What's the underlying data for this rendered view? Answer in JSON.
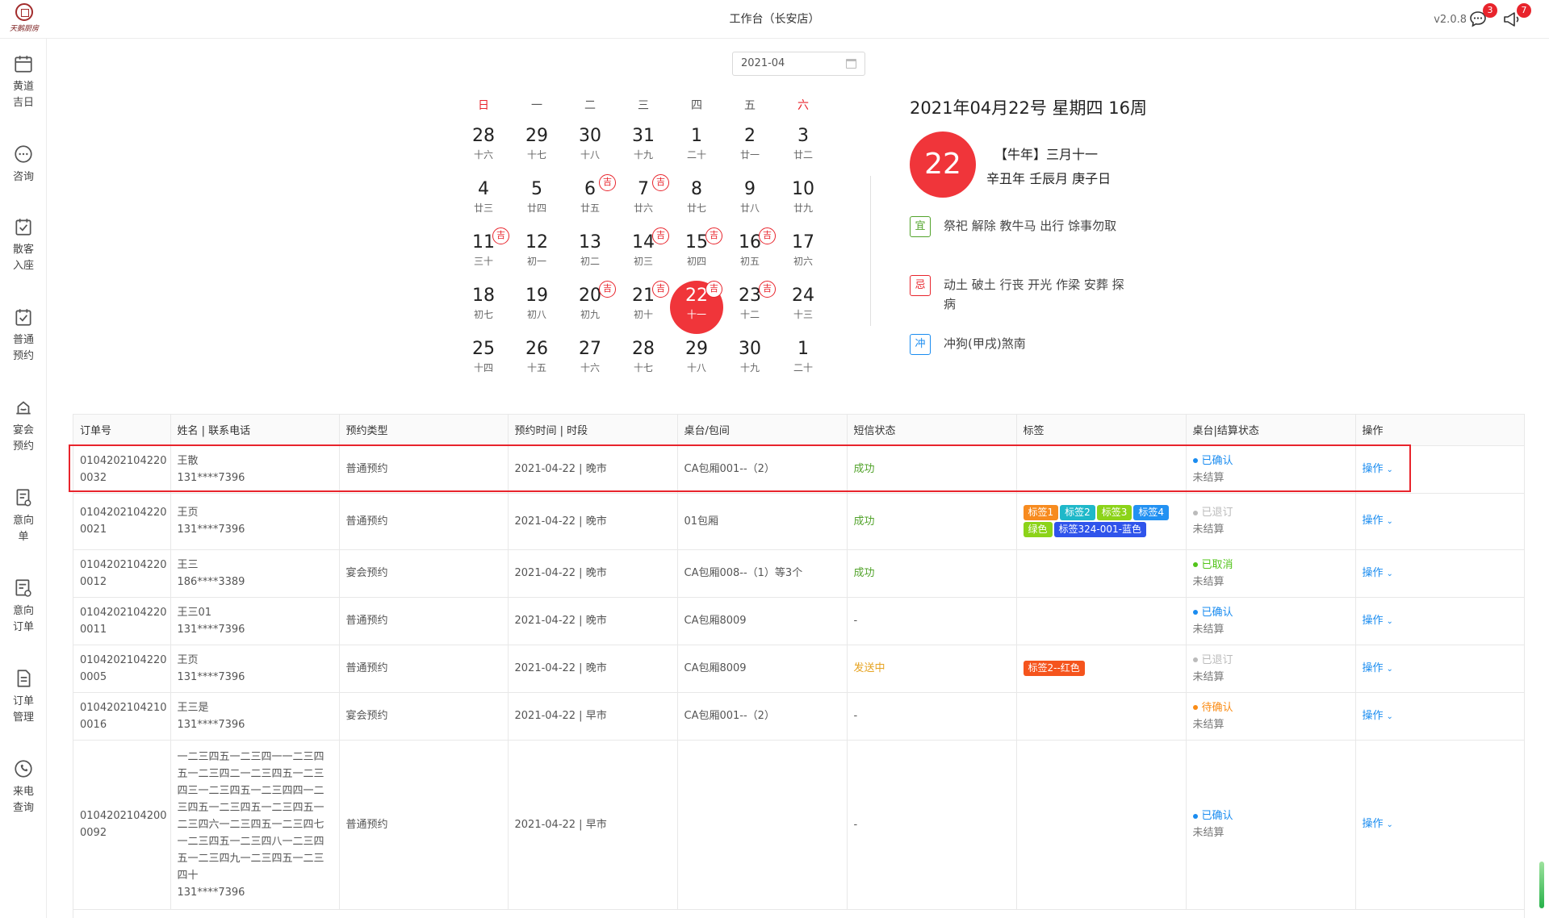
{
  "header": {
    "logo_text": "天鹅厨房",
    "title": "工作台（长安店）",
    "version": "v2.0.8",
    "message_badge": "3",
    "notice_badge": "7"
  },
  "sidebar": {
    "items": [
      {
        "icon": "calendar-icon",
        "label": "黄道\n吉日"
      },
      {
        "icon": "chat-icon",
        "label": "咨询"
      },
      {
        "icon": "checkin-icon",
        "label": "散客\n入座"
      },
      {
        "icon": "booking-icon",
        "label": "普通\n预约"
      },
      {
        "icon": "banquet-icon",
        "label": "宴会\n预约"
      },
      {
        "icon": "intent-icon",
        "label": "意向\n单"
      },
      {
        "icon": "intent-order-icon",
        "label": "意向\n订单"
      },
      {
        "icon": "order-icon",
        "label": "订单\n管理"
      },
      {
        "icon": "phone-icon",
        "label": "来电\n查询"
      }
    ]
  },
  "calendar": {
    "month": "2021-04",
    "weekdays": [
      "日",
      "一",
      "二",
      "三",
      "四",
      "五",
      "六"
    ],
    "ji_label": "吉",
    "weeks": [
      [
        {
          "d": "28",
          "l": "十六"
        },
        {
          "d": "29",
          "l": "十七"
        },
        {
          "d": "30",
          "l": "十八"
        },
        {
          "d": "31",
          "l": "十九"
        },
        {
          "d": "1",
          "l": "二十"
        },
        {
          "d": "2",
          "l": "廿一"
        },
        {
          "d": "3",
          "l": "廿二"
        }
      ],
      [
        {
          "d": "4",
          "l": "廿三"
        },
        {
          "d": "5",
          "l": "廿四"
        },
        {
          "d": "6",
          "l": "廿五",
          "ji": true
        },
        {
          "d": "7",
          "l": "廿六",
          "ji": true
        },
        {
          "d": "8",
          "l": "廿七"
        },
        {
          "d": "9",
          "l": "廿八"
        },
        {
          "d": "10",
          "l": "廿九"
        }
      ],
      [
        {
          "d": "11",
          "l": "三十",
          "ji": true
        },
        {
          "d": "12",
          "l": "初一"
        },
        {
          "d": "13",
          "l": "初二"
        },
        {
          "d": "14",
          "l": "初三",
          "ji": true
        },
        {
          "d": "15",
          "l": "初四",
          "ji": true
        },
        {
          "d": "16",
          "l": "初五",
          "ji": true
        },
        {
          "d": "17",
          "l": "初六"
        }
      ],
      [
        {
          "d": "18",
          "l": "初七"
        },
        {
          "d": "19",
          "l": "初八"
        },
        {
          "d": "20",
          "l": "初九",
          "ji": true
        },
        {
          "d": "21",
          "l": "初十",
          "ji": true
        },
        {
          "d": "22",
          "l": "十一",
          "ji": true,
          "selected": true
        },
        {
          "d": "23",
          "l": "十二",
          "ji": true
        },
        {
          "d": "24",
          "l": "十三"
        }
      ],
      [
        {
          "d": "25",
          "l": "十四"
        },
        {
          "d": "26",
          "l": "十五"
        },
        {
          "d": "27",
          "l": "十六"
        },
        {
          "d": "28",
          "l": "十七"
        },
        {
          "d": "29",
          "l": "十八"
        },
        {
          "d": "30",
          "l": "十九"
        },
        {
          "d": "1",
          "l": "二十"
        }
      ]
    ]
  },
  "day_detail": {
    "heading": "2021年04月22号 星期四 16周",
    "big_day": "22",
    "lunar_line1": "【牛年】三月十一",
    "lunar_line2": "辛丑年 壬辰月 庚子日",
    "yi_label": "宜",
    "yi_text": "祭祀 解除 教牛马 出行 馀事勿取",
    "ji_label": "忌",
    "ji_text": "动土 破土 行丧 开光 作梁 安葬 探病",
    "chong_label": "冲",
    "chong_text": "冲狗(甲戌)煞南"
  },
  "table": {
    "columns": [
      "订单号",
      "姓名 | 联系电话",
      "预约类型",
      "预约时间 | 时段",
      "桌台/包间",
      "短信状态",
      "标签",
      "桌台|结算状态",
      "操作"
    ],
    "op_label": "操作",
    "rows": [
      {
        "order": [
          "0104202104220",
          "0032"
        ],
        "name": "王散",
        "phone": "131****7396",
        "type": "普通预约",
        "time": "2021-04-22 | 晚市",
        "table": "CA包厢001--（2）",
        "sms": "成功",
        "sms_status": "ok",
        "tags": [],
        "status": "已确认",
        "status_color": "#1a8cf0",
        "settle": "未结算"
      },
      {
        "order": [
          "0104202104220",
          "0021"
        ],
        "name": "王页",
        "phone": "131****7396",
        "type": "普通预约",
        "time": "2021-04-22 | 晚市",
        "table": "01包厢",
        "sms": "成功",
        "sms_status": "ok",
        "tags": [
          {
            "text": "标签1",
            "color": "#f78b1f"
          },
          {
            "text": "标签2",
            "color": "#1fb8c9"
          },
          {
            "text": "标签3",
            "color": "#8cd319"
          },
          {
            "text": "标签4",
            "color": "#2291f2"
          },
          {
            "text": "绿色",
            "color": "#8cd319"
          },
          {
            "text": "标签324-001-蓝色",
            "color": "#2f54eb"
          }
        ],
        "status": "已退订",
        "status_color": "#bbbbbb",
        "settle": "未结算"
      },
      {
        "order": [
          "0104202104220",
          "0012"
        ],
        "name": "王三",
        "phone": "186****3389",
        "type": "宴会预约",
        "time": "2021-04-22 | 晚市",
        "table": "CA包厢008--（1）等3个",
        "sms": "成功",
        "sms_status": "ok",
        "tags": [],
        "status": "已取消",
        "status_color": "#52c41a",
        "settle": "未结算"
      },
      {
        "order": [
          "0104202104220",
          "0011"
        ],
        "name": "王三01",
        "phone": "131****7396",
        "type": "普通预约",
        "time": "2021-04-22 | 晚市",
        "table": "CA包厢8009",
        "sms": "-",
        "sms_status": "none",
        "tags": [],
        "status": "已确认",
        "status_color": "#1a8cf0",
        "settle": "未结算"
      },
      {
        "order": [
          "0104202104220",
          "0005"
        ],
        "name": "王页",
        "phone": "131****7396",
        "type": "普通预约",
        "time": "2021-04-22 | 晚市",
        "table": "CA包厢8009",
        "sms": "发送中",
        "sms_status": "sending",
        "tags": [
          {
            "text": "标签2--红色",
            "color": "#f5541d"
          }
        ],
        "status": "已退订",
        "status_color": "#bbbbbb",
        "settle": "未结算"
      },
      {
        "order": [
          "0104202104210",
          "0016"
        ],
        "name": "王三是",
        "phone": "131****7396",
        "type": "宴会预约",
        "time": "2021-04-22 | 早市",
        "table": "CA包厢001--（2）",
        "sms": "-",
        "sms_status": "none",
        "tags": [],
        "status": "待确认",
        "status_color": "#fa8c16",
        "settle": "未结算"
      },
      {
        "order": [
          "0104202104200",
          "0092"
        ],
        "name": "一二三四五一二三四一一二三四五一二三四二一二三四五一二三四三一二三四五一二三四四一二三四五一二三四五一二三四五一二三四六一二三四五一二三四七一二三四五一二三四八一二三四五一二三四九一二三四五一二三四十",
        "phone": "131****7396",
        "type": "普通预约",
        "time": "2021-04-22 | 早市",
        "table": "",
        "sms": "-",
        "sms_status": "none",
        "tags": [],
        "status": "已确认",
        "status_color": "#1a8cf0",
        "settle": "未结算"
      }
    ]
  },
  "colors": {
    "accent_red": "#f0353a",
    "link_blue": "#1a8cf0",
    "yi_green": "#52a32b",
    "ji_red": "#e8242c",
    "chong_blue": "#1a8cf0"
  }
}
